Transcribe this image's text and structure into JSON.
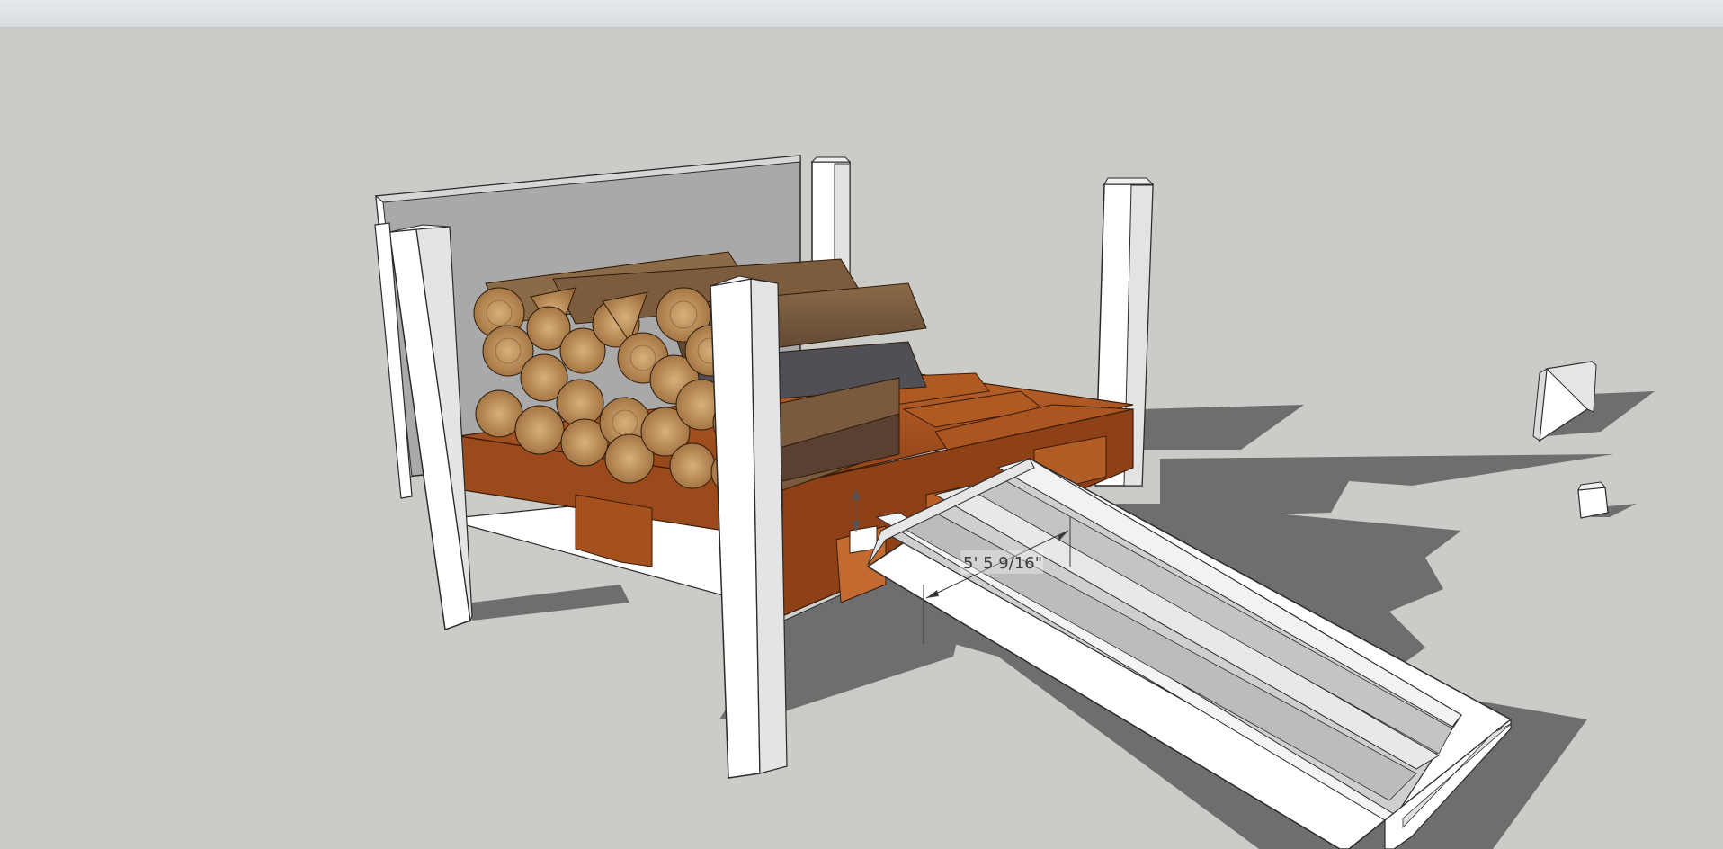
{
  "app": {
    "title": ""
  },
  "viewport": {
    "background": "#cbccc7",
    "shadow_color": "#6e6e6e",
    "wood_color": "#a24e1c",
    "post_color": "#ffffff",
    "panel_color": "#a9a9a9"
  },
  "model": {
    "dimension_label": "5' 5 9/16\"",
    "components": [
      "back-panel",
      "white-posts",
      "pallet",
      "firewood-stack",
      "ramp",
      "small-block",
      "tiny-block"
    ]
  }
}
